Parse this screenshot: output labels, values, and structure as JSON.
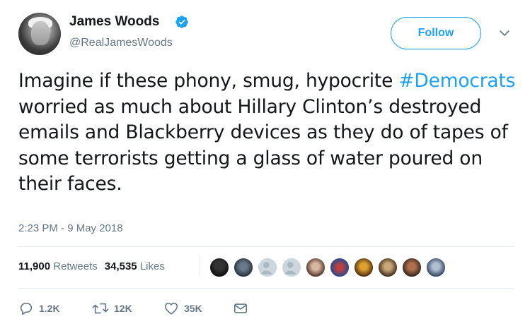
{
  "author": {
    "name": "James Woods",
    "handle": "@RealJamesWoods",
    "verified": true
  },
  "follow_label": "Follow",
  "tweet": {
    "before_hashtag": "Imagine if these phony, smug, hypocrite ",
    "hashtag": "#Democrats",
    "after_hashtag": " worried as much about Hillary Clinton’s destroyed emails and Blackberry devices as they do of tapes of some terrorists getting a glass of water poured on their faces.",
    "timestamp": "2:23 PM - 9 May 2018"
  },
  "stats": {
    "retweets_count": "11,900",
    "retweets_label": "Retweets",
    "likes_count": "34,535",
    "likes_label": "Likes"
  },
  "actions": {
    "reply_count": "1.2K",
    "retweet_count": "12K",
    "like_count": "35K"
  },
  "colors": {
    "accent": "#1da1f2",
    "text": "#14171a",
    "muted": "#657786"
  },
  "likers": [
    "liker-1",
    "liker-2",
    "liker-3",
    "liker-4",
    "liker-5",
    "liker-6",
    "liker-7",
    "liker-8",
    "liker-9",
    "liker-10"
  ]
}
